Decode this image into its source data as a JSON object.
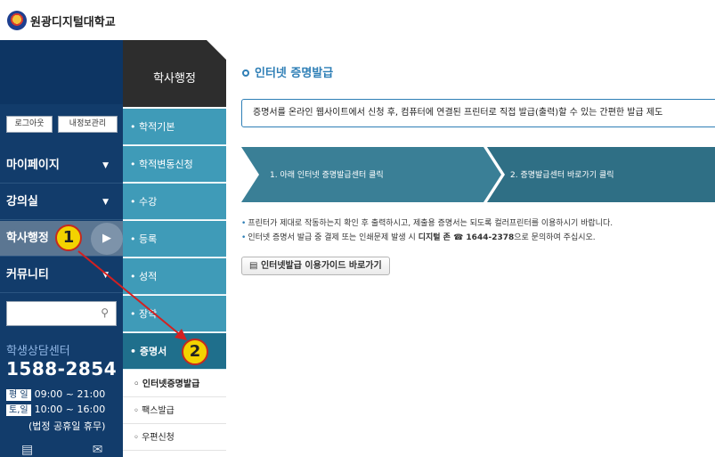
{
  "header": {
    "school_name": "원광디지털대학교"
  },
  "left_nav": {
    "logout": "로그아웃",
    "profile": "내정보관리",
    "items": [
      {
        "label": "마이페이지",
        "arrow": "▼"
      },
      {
        "label": "강의실",
        "arrow": "▼"
      },
      {
        "label": "학사행정",
        "arrow": "▶"
      },
      {
        "label": "커뮤니티",
        "arrow": "▼"
      }
    ],
    "search_placeholder": "",
    "counsel_title": "학생상담센터",
    "counsel_phone": "1588-2854",
    "weekday_tag": "평 일",
    "weekday_hours": "09:00 ~ 21:00",
    "saturday_tag": "토,일",
    "saturday_hours": "10:00 ~ 16:00",
    "holiday_note": "(법정 공휴일 휴무)"
  },
  "sub_nav": {
    "title": "학사행정",
    "items": [
      "학적기본",
      "학적변동신청",
      "수강",
      "등록",
      "성적",
      "장학",
      "증명서"
    ],
    "sub_items": [
      "인터넷증명발급",
      "팩스발급",
      "우편신청"
    ]
  },
  "main": {
    "title": "인터넷 증명발급",
    "description": "증명서를 온라인 웹사이트에서 신청 후, 컴퓨터에 연결된 프린터로 직접 발급(출력)할 수 있는 간편한 발급 제도",
    "steps": [
      "1. 아래 인터넷 증명발급센터 클릭",
      "2. 증명발급센터 바로가기 클릭"
    ],
    "note1": "프린터가 제대로 작동하는지 확인 후 출력하시고, 제출용 증명서는 되도록 컬러프린터를 이용하시기 바랍니다.",
    "note2_prefix": "인터넷 증명서 발급 중 결제 또는 인쇄문제 발생 시",
    "note2_bold": "디지털 존 ☎ 1644-2378",
    "note2_suffix": "으로 문의하여 주십시오.",
    "guide_button": "인터넷발급 이용가이드 바로가기"
  },
  "annotations": {
    "badge1": "1",
    "badge2": "2"
  },
  "colors": {
    "nav_dark": "#123c6b",
    "sub_teal": "#3f9bb8",
    "accent": "#2f7fb6",
    "arrow_red": "#d42020"
  }
}
